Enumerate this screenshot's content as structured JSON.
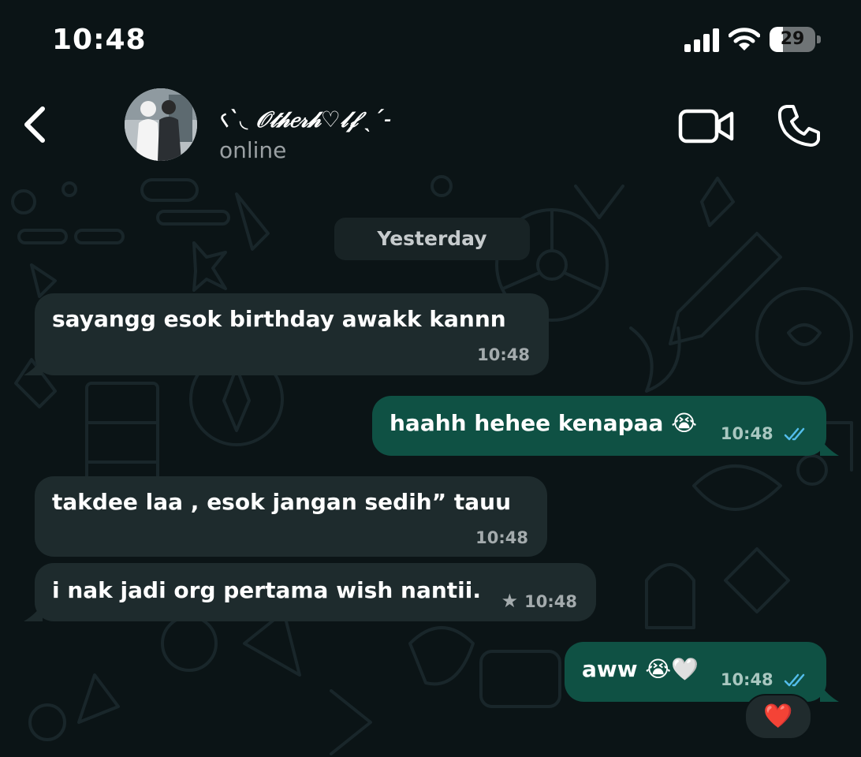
{
  "status_bar": {
    "time": "10:48",
    "battery_level": "29",
    "battery_fraction": 0.29,
    "icons": [
      "cellular-signal-icon",
      "wifi-icon",
      "battery-icon"
    ]
  },
  "header": {
    "contact_name": "৻ˋ◟ 𝒪𝓉𝒽𝑒𝓇𝒽♡𝓁𝒻 ˎˊ˗",
    "status": "online",
    "icons": [
      "back-chevron-icon",
      "video-camera-icon",
      "phone-icon"
    ]
  },
  "chat": {
    "date_separator": "Yesterday",
    "messages": [
      {
        "direction": "incoming",
        "text": "sayangg esok birthday awakk kannn",
        "time": "10:48"
      },
      {
        "direction": "outgoing",
        "text": "haahh hehee kenapaa 😭",
        "time": "10:48",
        "status": "read"
      },
      {
        "direction": "incoming",
        "text": "takdee laa , esok jangan sedih” tauu",
        "time": "10:48"
      },
      {
        "direction": "incoming",
        "text": "i nak jadi org pertama wish nantii.",
        "time": "10:48",
        "starred": true
      },
      {
        "direction": "outgoing",
        "text": "aww 😭🤍",
        "time": "10:48",
        "status": "read",
        "reaction": "❤️"
      }
    ]
  },
  "colors": {
    "background": "#0b1416",
    "incoming_bubble": "#1e2b2d",
    "outgoing_bubble": "#0f5144",
    "read_check": "#53bdeb",
    "timestamp": "#a4abad"
  }
}
